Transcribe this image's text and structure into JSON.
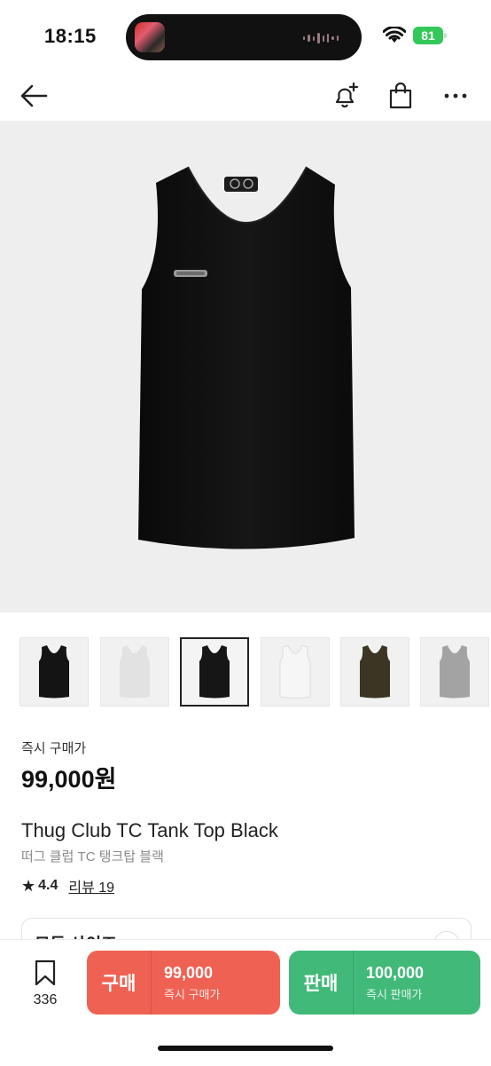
{
  "status_bar": {
    "time": "18:15",
    "battery": "81"
  },
  "product": {
    "instant_buy_label": "즉시 구매가",
    "price": "99,000원",
    "name_en": "Thug Club TC Tank Top Black",
    "name_ko": "떠그 클럽 TC 탱크탑 블랙",
    "rating": "4.4",
    "review_label": "리뷰 19"
  },
  "thumbnails": [
    {
      "color": "#141414",
      "selected": false
    },
    {
      "color": "#e2e2e2",
      "selected": false
    },
    {
      "color": "#161616",
      "selected": true
    },
    {
      "color": "#f6f6f6",
      "selected": false
    },
    {
      "color": "#3b3524",
      "selected": false
    },
    {
      "color": "#a3a3a3",
      "selected": false
    }
  ],
  "size_selector": {
    "label": "모든 사이즈"
  },
  "bottom_bar": {
    "wish_count": "336",
    "buy": {
      "label": "구매",
      "price": "99,000",
      "sub": "즉시 구매가",
      "color": "#ef6253"
    },
    "sell": {
      "label": "판매",
      "price": "100,000",
      "sub": "즉시 판매가",
      "color": "#41b979"
    }
  }
}
